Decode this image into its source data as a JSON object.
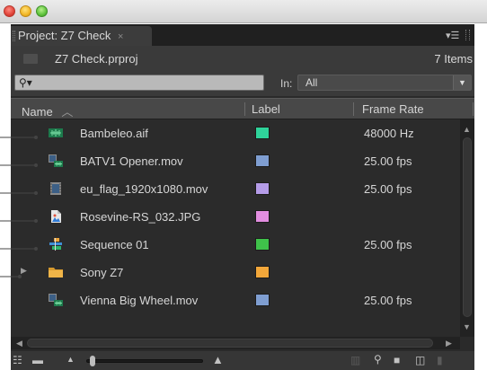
{
  "window": {
    "traffic_lights": [
      "close",
      "minimize",
      "zoom"
    ]
  },
  "panel": {
    "tab_title": "Project: Z7 Check",
    "tab_close": "×",
    "menu_icon": "panel-menu-icon"
  },
  "project": {
    "file_name": "Z7 Check.prproj",
    "item_count": "7 Items"
  },
  "search": {
    "icon": "⚲▾",
    "value": "",
    "in_label": "In:",
    "in_value": "All"
  },
  "columns": {
    "name": "Name",
    "sort_indicator": "︿",
    "label": "Label",
    "frame_rate": "Frame Rate"
  },
  "items": [
    {
      "name": "Bambeleo.aif",
      "icon": "audio-clip-icon",
      "label_color": "#2fd39a",
      "frame_rate": "48000 Hz",
      "expandable": false
    },
    {
      "name": "BATV1 Opener.mov",
      "icon": "video-audio-clip-icon",
      "label_color": "#7f9ed1",
      "frame_rate": "25.00 fps",
      "expandable": false
    },
    {
      "name": "eu_flag_1920x1080.mov",
      "icon": "video-clip-icon",
      "label_color": "#b59ce8",
      "frame_rate": "25.00 fps",
      "expandable": false
    },
    {
      "name": "Rosevine-RS_032.JPG",
      "icon": "still-image-icon",
      "label_color": "#e28ee0",
      "frame_rate": "",
      "expandable": false
    },
    {
      "name": "Sequence 01",
      "icon": "sequence-icon",
      "label_color": "#3fc24a",
      "frame_rate": "25.00 fps",
      "expandable": false
    },
    {
      "name": "Sony Z7",
      "icon": "folder-icon",
      "label_color": "#f2a73a",
      "frame_rate": "",
      "expandable": true
    },
    {
      "name": "Vienna Big Wheel.mov",
      "icon": "video-audio-clip-icon",
      "label_color": "#7f9ed1",
      "frame_rate": "25.00 fps",
      "expandable": false
    }
  ],
  "colors": {
    "panel_bg": "#2a2a2a",
    "header_bg": "#484848",
    "text": "#d6d6d6",
    "search_bg": "#b9b9b9"
  }
}
